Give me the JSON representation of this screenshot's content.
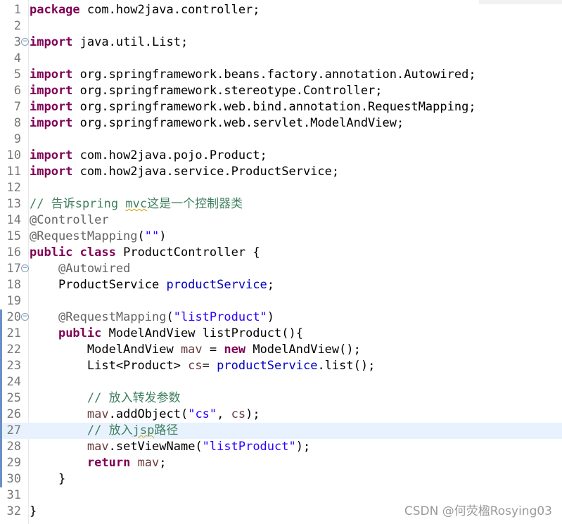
{
  "editor": {
    "lines": [
      {
        "n": "1",
        "tokens": [
          {
            "t": "package",
            "c": "kw"
          },
          {
            "t": " com.how2java.controller;",
            "c": ""
          }
        ]
      },
      {
        "n": "2",
        "tokens": []
      },
      {
        "n": "3",
        "fold": true,
        "tokens": [
          {
            "t": "import",
            "c": "kw"
          },
          {
            "t": " java.util.List;",
            "c": ""
          }
        ]
      },
      {
        "n": "4",
        "tokens": []
      },
      {
        "n": "5",
        "tokens": [
          {
            "t": "import",
            "c": "kw"
          },
          {
            "t": " org.springframework.beans.factory.annotation.Autowired;",
            "c": ""
          }
        ]
      },
      {
        "n": "6",
        "tokens": [
          {
            "t": "import",
            "c": "kw"
          },
          {
            "t": " org.springframework.stereotype.Controller;",
            "c": ""
          }
        ]
      },
      {
        "n": "7",
        "tokens": [
          {
            "t": "import",
            "c": "kw"
          },
          {
            "t": " org.springframework.web.bind.annotation.RequestMapping;",
            "c": ""
          }
        ]
      },
      {
        "n": "8",
        "tokens": [
          {
            "t": "import",
            "c": "kw"
          },
          {
            "t": " org.springframework.web.servlet.ModelAndView;",
            "c": ""
          }
        ]
      },
      {
        "n": "9",
        "tokens": []
      },
      {
        "n": "10",
        "tokens": [
          {
            "t": "import",
            "c": "kw"
          },
          {
            "t": " com.how2java.pojo.Product;",
            "c": ""
          }
        ]
      },
      {
        "n": "11",
        "tokens": [
          {
            "t": "import",
            "c": "kw"
          },
          {
            "t": " com.how2java.service.ProductService;",
            "c": ""
          }
        ]
      },
      {
        "n": "12",
        "tokens": []
      },
      {
        "n": "13",
        "tokens": [
          {
            "t": "// 告诉spring ",
            "c": "cm"
          },
          {
            "t": "mvc",
            "c": "cm sq"
          },
          {
            "t": "这是一个控制器类",
            "c": "cm"
          }
        ]
      },
      {
        "n": "14",
        "tokens": [
          {
            "t": "@Controller",
            "c": "ann"
          }
        ]
      },
      {
        "n": "15",
        "tokens": [
          {
            "t": "@RequestMapping",
            "c": "ann"
          },
          {
            "t": "(",
            "c": ""
          },
          {
            "t": "\"\"",
            "c": "str"
          },
          {
            "t": ")",
            "c": ""
          }
        ]
      },
      {
        "n": "16",
        "tokens": [
          {
            "t": "public",
            "c": "kw"
          },
          {
            "t": " ",
            "c": ""
          },
          {
            "t": "class",
            "c": "kw"
          },
          {
            "t": " ProductController {",
            "c": ""
          }
        ]
      },
      {
        "n": "17",
        "fold": true,
        "tokens": [
          {
            "t": "    ",
            "c": ""
          },
          {
            "t": "@Autowired",
            "c": "ann"
          }
        ]
      },
      {
        "n": "18",
        "tokens": [
          {
            "t": "    ProductService ",
            "c": ""
          },
          {
            "t": "productService",
            "c": "fld"
          },
          {
            "t": ";",
            "c": ""
          }
        ]
      },
      {
        "n": "19",
        "tokens": []
      },
      {
        "n": "20",
        "fold": true,
        "marker": true,
        "tokens": [
          {
            "t": "    ",
            "c": ""
          },
          {
            "t": "@RequestMapping",
            "c": "ann"
          },
          {
            "t": "(",
            "c": ""
          },
          {
            "t": "\"listProduct\"",
            "c": "str"
          },
          {
            "t": ")",
            "c": ""
          }
        ]
      },
      {
        "n": "21",
        "marker": true,
        "tokens": [
          {
            "t": "    ",
            "c": ""
          },
          {
            "t": "public",
            "c": "kw"
          },
          {
            "t": " ModelAndView listProduct(){",
            "c": ""
          }
        ]
      },
      {
        "n": "22",
        "marker": true,
        "tokens": [
          {
            "t": "        ModelAndView ",
            "c": ""
          },
          {
            "t": "mav",
            "c": "lv"
          },
          {
            "t": " = ",
            "c": ""
          },
          {
            "t": "new",
            "c": "kw"
          },
          {
            "t": " ModelAndView();",
            "c": ""
          }
        ]
      },
      {
        "n": "23",
        "marker": true,
        "tokens": [
          {
            "t": "        List<Product> ",
            "c": ""
          },
          {
            "t": "cs",
            "c": "lv"
          },
          {
            "t": "= ",
            "c": ""
          },
          {
            "t": "productService",
            "c": "fld"
          },
          {
            "t": ".list();",
            "c": ""
          }
        ]
      },
      {
        "n": "24",
        "marker": true,
        "tokens": []
      },
      {
        "n": "25",
        "marker": true,
        "tokens": [
          {
            "t": "        ",
            "c": ""
          },
          {
            "t": "// 放入转发参数",
            "c": "cm"
          }
        ]
      },
      {
        "n": "26",
        "marker": true,
        "tokens": [
          {
            "t": "        ",
            "c": ""
          },
          {
            "t": "mav",
            "c": "lv"
          },
          {
            "t": ".addObject(",
            "c": ""
          },
          {
            "t": "\"cs\"",
            "c": "str"
          },
          {
            "t": ", ",
            "c": ""
          },
          {
            "t": "cs",
            "c": "lv"
          },
          {
            "t": ");",
            "c": ""
          }
        ]
      },
      {
        "n": "27",
        "marker": true,
        "current": true,
        "tokens": [
          {
            "t": "        ",
            "c": ""
          },
          {
            "t": "// 放入",
            "c": "cm"
          },
          {
            "t": "jsp",
            "c": "cm sq"
          },
          {
            "t": "路径",
            "c": "cm"
          }
        ]
      },
      {
        "n": "28",
        "marker": true,
        "tokens": [
          {
            "t": "        ",
            "c": ""
          },
          {
            "t": "mav",
            "c": "lv"
          },
          {
            "t": ".setViewName(",
            "c": ""
          },
          {
            "t": "\"listProduct\"",
            "c": "str"
          },
          {
            "t": ");",
            "c": ""
          }
        ]
      },
      {
        "n": "29",
        "marker": true,
        "tokens": [
          {
            "t": "        ",
            "c": ""
          },
          {
            "t": "return",
            "c": "kw"
          },
          {
            "t": " ",
            "c": ""
          },
          {
            "t": "mav",
            "c": "lv"
          },
          {
            "t": ";",
            "c": ""
          }
        ]
      },
      {
        "n": "30",
        "marker": true,
        "tokens": [
          {
            "t": "    }",
            "c": ""
          }
        ]
      },
      {
        "n": "31",
        "tokens": []
      },
      {
        "n": "32",
        "tokens": [
          {
            "t": "}",
            "c": ""
          }
        ]
      }
    ]
  },
  "watermark": "CSDN @何荧楹Rosying03",
  "colors": {
    "keyword": "#7f0055",
    "annotation": "#646464",
    "comment": "#3f7f5f",
    "field": "#0000c0",
    "string": "#2a00ff",
    "local_var": "#6a3e3e",
    "current_line": "#e8f2fe"
  }
}
